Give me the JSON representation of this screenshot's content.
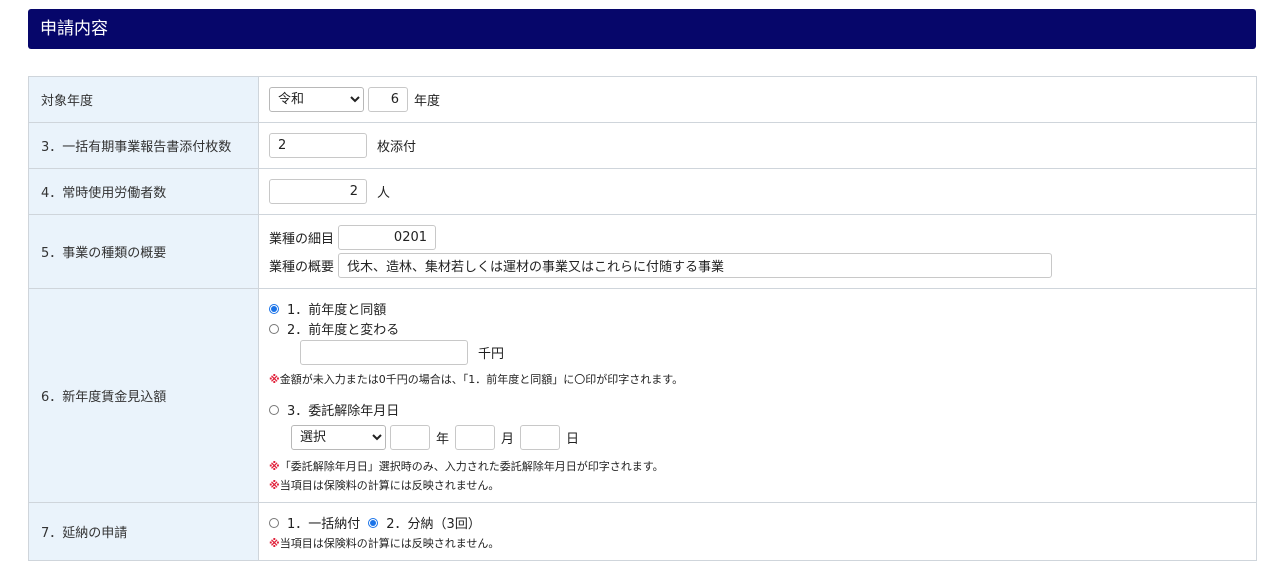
{
  "header": {
    "title": "申請内容"
  },
  "rows": {
    "year": {
      "label": "対象年度",
      "era_selected": "令和",
      "year_value": "6",
      "unit": "年度"
    },
    "attach": {
      "label": "3．一括有期事業報告書添付枚数",
      "value": "2",
      "unit": "枚添付"
    },
    "workers": {
      "label": "4．常時使用労働者数",
      "value": "2",
      "unit": "人"
    },
    "business": {
      "label": "5．事業の種類の概要",
      "detail_label": "業種の細目",
      "detail_value": "0201",
      "summary_label": "業種の概要",
      "summary_value": "伐木、造林、集材若しくは運材の事業又はこれらに付随する事業"
    },
    "wage": {
      "label": "6．新年度賃金見込額",
      "opt1": "1．前年度と同額",
      "opt2": "2．前年度と変わる",
      "amount_value": "",
      "amount_unit": "千円",
      "note1_mark": "※",
      "note1": "金額が未入力または0千円の場合は、「1．前年度と同額」に〇印が印字されます。",
      "opt3": "3．委託解除年月日",
      "date_era": "選択",
      "date_year_unit": "年",
      "date_month_unit": "月",
      "date_day_unit": "日",
      "note2_mark": "※",
      "note2": "「委託解除年月日」選択時のみ、入力された委託解除年月日が印字されます。",
      "note3_mark": "※",
      "note3": "当項目は保険料の計算には反映されません。",
      "selected_option": 1
    },
    "deferral": {
      "label": "7．延納の申請",
      "opt1": "1．一括納付",
      "opt2": "2．分納（3回）",
      "selected_option": 2,
      "note_mark": "※",
      "note": "当項目は保険料の計算には反映されません。"
    }
  }
}
